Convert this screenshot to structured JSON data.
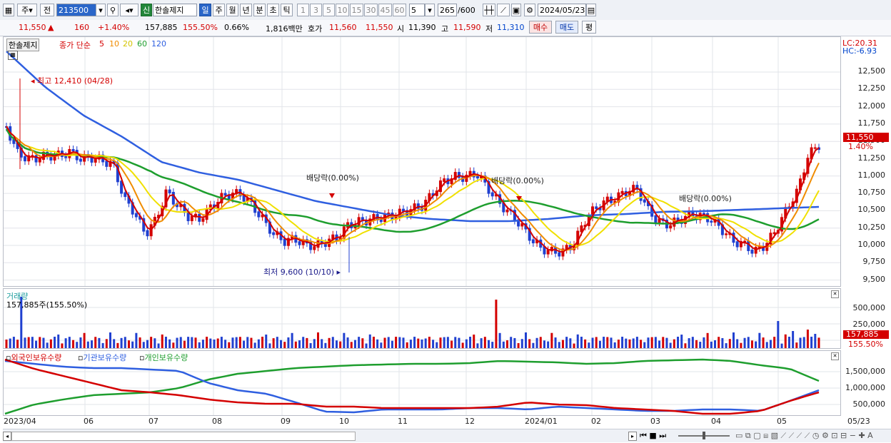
{
  "toolbar": {
    "jong_label": "주",
    "jeon_label": "전",
    "code": "213500",
    "sin_label": "신",
    "stock_name": "한솔제지",
    "periods": [
      "일",
      "주",
      "월",
      "년",
      "분",
      "초",
      "틱"
    ],
    "active_period": "일",
    "numbers": [
      "1",
      "3",
      "5",
      "10",
      "15",
      "30",
      "45",
      "60"
    ],
    "interval": "5",
    "count": "265",
    "count_total": "/600",
    "date": "2024/05/23"
  },
  "quote": {
    "price": "11,550",
    "arrow": "▲",
    "change": "160",
    "change_pct": "+1.40%",
    "volume": "157,885",
    "volume_ratio": "155.50%",
    "turnover": "0.66%",
    "amount": "1,816백만",
    "hoga_label": "호가",
    "ask": "11,560",
    "bid": "11,550",
    "open_label": "시",
    "open": "11,390",
    "high_label": "고",
    "high": "11,590",
    "low_label": "저",
    "low": "11,310",
    "buy_label": "매수",
    "sell_label": "매도",
    "eval_label": "평"
  },
  "price_panel": {
    "legend_name": "한솔제지",
    "legend_ma": "종가 단순",
    "ma_periods": [
      "5",
      "10",
      "20",
      "60",
      "120"
    ],
    "lc": "LC:20.31",
    "hc": "HC:-6.93",
    "y_ticks": [
      "12,500",
      "12,250",
      "12,000",
      "11,750",
      "11,500",
      "11,250",
      "11,000",
      "10,750",
      "10,500",
      "10,250",
      "10,000",
      "9,750",
      "9,500"
    ],
    "last_price": "11,550",
    "last_pct": "1.40%",
    "high_annot": "최고 12,410 (04/28)",
    "low_annot": "최저 9,600 (10/10)",
    "div1": "배당락(0.00%)",
    "div2": "배당락(0.00%)",
    "div3": "배당락(0.00%)"
  },
  "volume_panel": {
    "title": "거래량",
    "value": "157,885주(155.50%)",
    "y_ticks": [
      "500,000",
      "250,000"
    ],
    "last": "157,885",
    "last_pct": "155.50%"
  },
  "holding_panel": {
    "foreign": "외국인보유수량",
    "inst": "기관보유수량",
    "retail": "개인보유수량",
    "y_ticks": [
      "1,500,000",
      "1,000,000",
      "500,000"
    ]
  },
  "x_labels": [
    "2023/04",
    "06",
    "07",
    "08",
    "09",
    "10",
    "11",
    "12",
    "2024/01",
    "02",
    "03",
    "04",
    "05",
    "05/23"
  ],
  "colors": {
    "ma5": "#d40000",
    "ma10": "#f08c00",
    "ma20": "#f0e000",
    "ma60": "#1e9e2e",
    "ma120": "#2f5fe0",
    "up": "#d40000",
    "down": "#2040d0"
  }
}
